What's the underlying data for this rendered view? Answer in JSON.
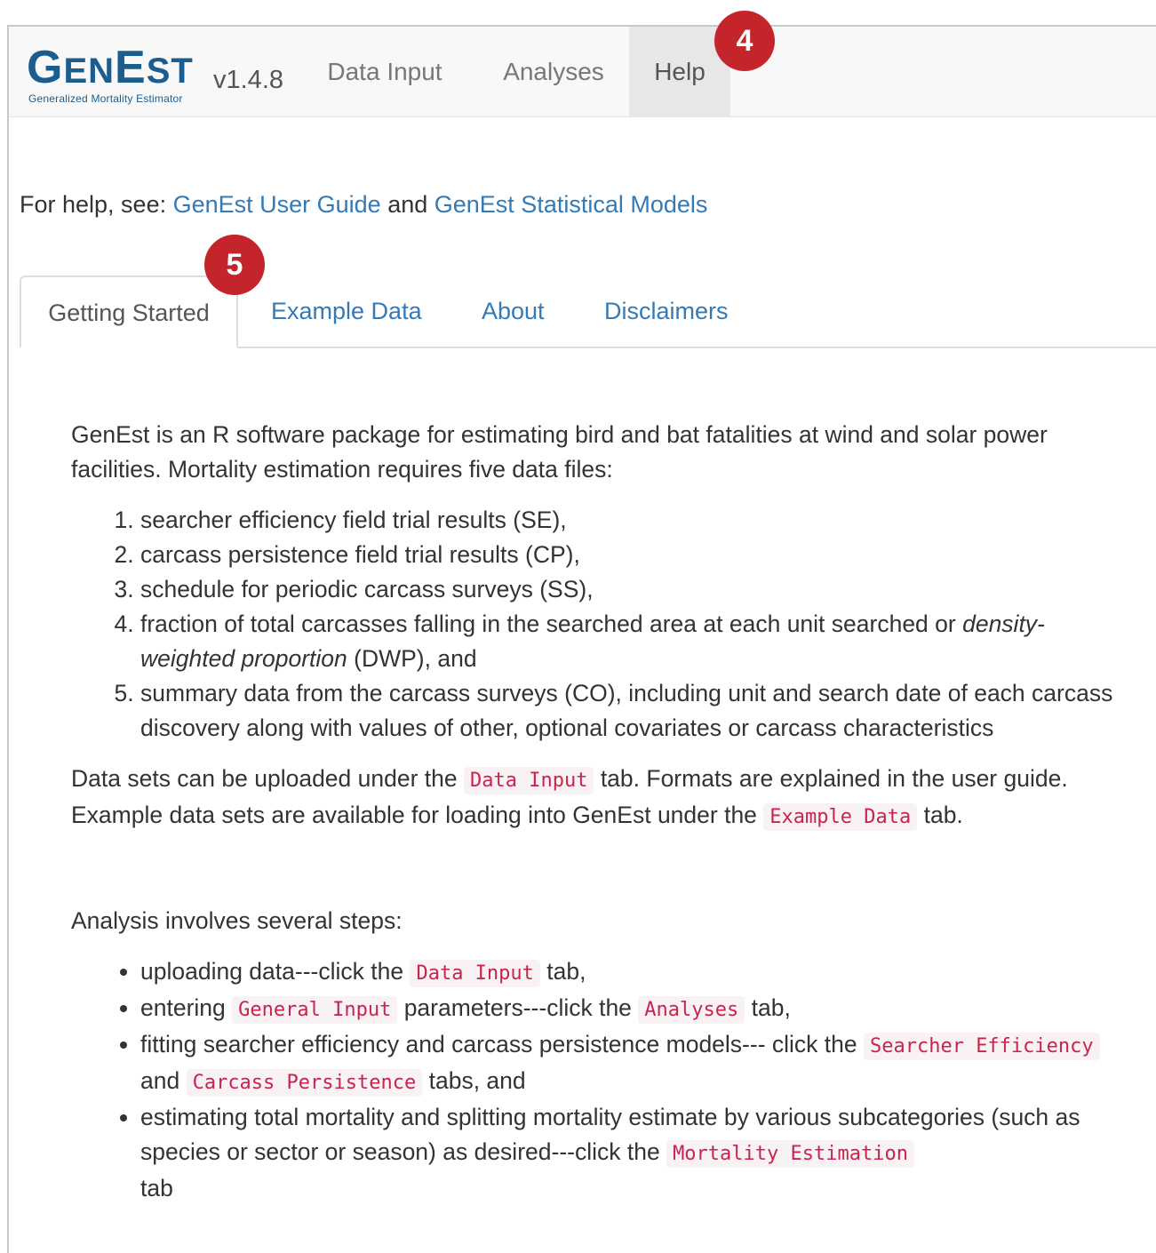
{
  "app": {
    "brand_main": "GenEst",
    "brand_tagline": "Generalized Mortality Estimator",
    "version": "v1.4.8"
  },
  "nav": {
    "items": [
      {
        "label": "Data Input"
      },
      {
        "label": "Analyses"
      },
      {
        "label": "Help",
        "active": true
      }
    ]
  },
  "callouts": {
    "badge_help": "4",
    "badge_tabs": "5"
  },
  "help_line": {
    "prefix": "For help, see: ",
    "link1": "GenEst User Guide",
    "middle": " and ",
    "link2": "GenEst Statistical Models"
  },
  "tabs": [
    {
      "label": "Getting Started",
      "active": true
    },
    {
      "label": "Example Data"
    },
    {
      "label": "About"
    },
    {
      "label": "Disclaimers"
    }
  ],
  "content": {
    "intro": "GenEst is an R software package for estimating bird and bat fatalities at wind and solar power facilities. Mortality estimation requires five data files:",
    "files": [
      {
        "text": "searcher efficiency field trial results (SE),"
      },
      {
        "text": "carcass persistence field trial results (CP),"
      },
      {
        "text": "schedule for periodic carcass surveys (SS),"
      },
      {
        "text_before": "fraction of total carcasses falling in the searched area at each unit searched or ",
        "italic": "density-weighted proportion",
        "text_after": " (DWP), and"
      },
      {
        "text": "summary data from the carcass surveys (CO), including unit and search date of each carcass discovery along with values of other, optional covariates or carcass characteristics"
      }
    ],
    "data_sets": {
      "t1": "Data sets can be uploaded under the ",
      "code1": "Data Input",
      "t2": " tab. Formats are explained in the user guide. Example data sets are available for loading into GenEst under the ",
      "code2": "Example Data",
      "t3": " tab."
    },
    "analysis_intro": "Analysis involves several steps:",
    "steps": {
      "s1": {
        "t1": "uploading data---click the ",
        "code1": "Data Input",
        "t2": " tab,"
      },
      "s2": {
        "t1": "entering ",
        "code1": "General Input",
        "t2": " parameters---click the ",
        "code2": "Analyses",
        "t3": " tab,"
      },
      "s3": {
        "t1": "fitting searcher efficiency and carcass persistence models--- click the ",
        "code1": "Searcher Efficiency",
        "t2": " and ",
        "code2": "Carcass Persistence",
        "t3": " tabs, and"
      },
      "s4": {
        "t1": "estimating total mortality and splitting mortality estimate by various subcategories (such as species or sector or season) as desired---click the ",
        "code1": "Mortality Estimation",
        "t2": " tab"
      }
    }
  },
  "colors": {
    "brand": "#1b5d8e",
    "link": "#337ab7",
    "code_text": "#c7254e",
    "code_bg": "#f9f2f4",
    "callout": "#c4252a",
    "navbar_bg": "#f8f8f8",
    "nav_active_bg": "#e7e7e7"
  }
}
